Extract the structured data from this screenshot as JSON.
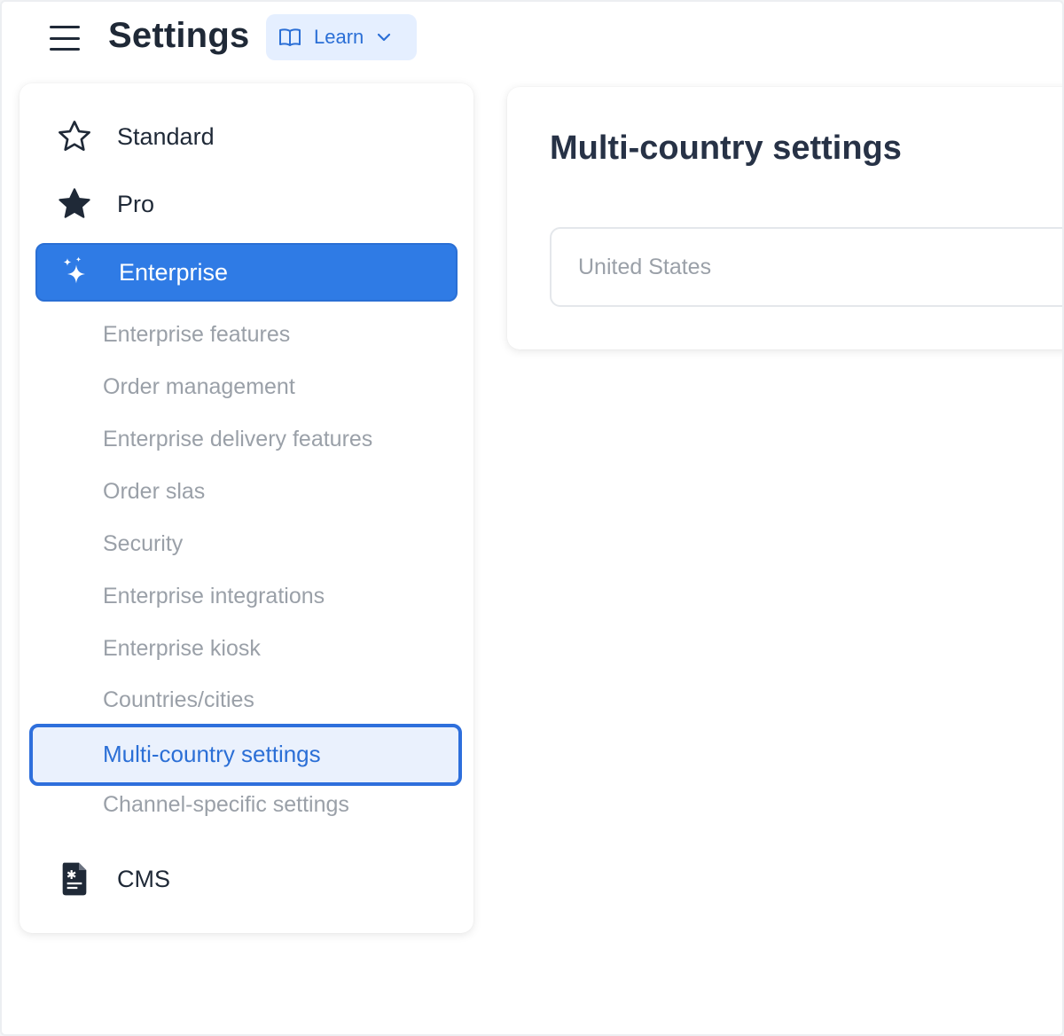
{
  "header": {
    "title": "Settings",
    "learn_label": "Learn",
    "menu_icon": "hamburger-menu-icon",
    "learn_icon": "book-open-icon",
    "learn_chevron": "chevron-down-icon"
  },
  "sidebar": {
    "main_items": [
      {
        "label": "Standard",
        "icon": "star-outline-icon"
      },
      {
        "label": "Pro",
        "icon": "star-filled-icon"
      },
      {
        "label": "Enterprise",
        "icon": "sparkles-icon",
        "active": true
      }
    ],
    "enterprise_subitems": [
      "Enterprise features",
      "Order management",
      "Enterprise delivery features",
      "Order slas",
      "Security",
      "Enterprise integrations",
      "Enterprise kiosk",
      "Countries/cities",
      "Multi-country settings",
      "Channel-specific settings"
    ],
    "active_subitem": "Multi-country settings",
    "cms": {
      "label": "CMS",
      "icon": "document-icon"
    }
  },
  "main": {
    "card_title": "Multi-country settings",
    "country_placeholder": "United States"
  },
  "colors": {
    "accent": "#2f7be5",
    "accent_text": "#2b6fd6",
    "learn_bg": "#e5efff",
    "muted_text": "#9aa0a8",
    "dark_text": "#1f2937"
  }
}
